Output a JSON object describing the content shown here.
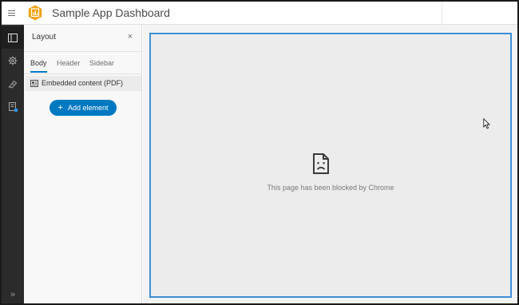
{
  "header": {
    "menu_icon": "hamburger-menu-icon",
    "logo_icon": "dashboard-app-logo-icon",
    "title": "Sample App Dashboard"
  },
  "rail": {
    "items": [
      {
        "name": "layout",
        "icon": "layout-panel-icon",
        "active": true
      },
      {
        "name": "settings",
        "icon": "gear-icon",
        "active": false
      },
      {
        "name": "theme",
        "icon": "theme-brush-icon",
        "active": false
      },
      {
        "name": "data",
        "icon": "data-sources-icon",
        "active": false
      }
    ],
    "expand_label": "»"
  },
  "panel": {
    "title": "Layout",
    "close_label": "×",
    "tabs": [
      {
        "label": "Body",
        "active": true
      },
      {
        "label": "Header",
        "active": false
      },
      {
        "label": "Sidebar",
        "active": false
      }
    ],
    "elements": [
      {
        "label": "Embedded content (PDF)",
        "icon": "embedded-content-icon"
      }
    ],
    "add_button": {
      "plus": "+",
      "label": "Add element"
    }
  },
  "canvas": {
    "blocked_icon": "sad-document-icon",
    "blocked_message": "This page has been blocked by Chrome"
  },
  "colors": {
    "accent": "#0079c1",
    "selection_border": "#3e8fd6",
    "rail_background": "#2b2b2b",
    "logo_orange": "#f0a212"
  }
}
